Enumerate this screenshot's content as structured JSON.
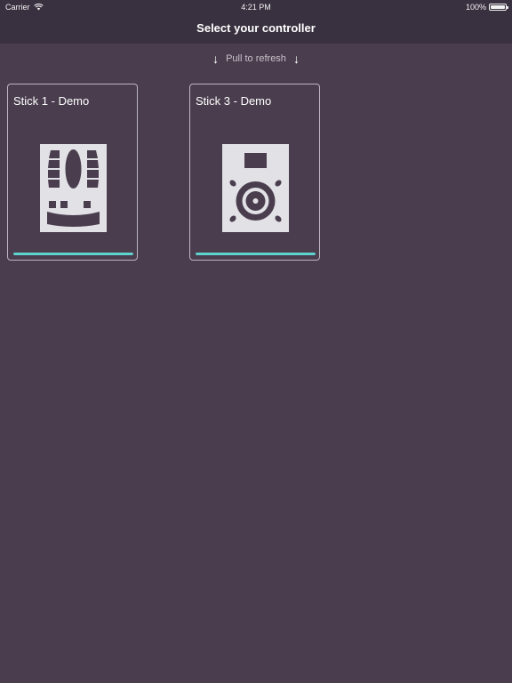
{
  "status_bar": {
    "carrier": "Carrier",
    "wifi_icon": "wifi-icon",
    "time": "4:21 PM",
    "battery_percent": "100%",
    "battery_level": 1.0
  },
  "nav": {
    "title": "Select your controller"
  },
  "pull_hint": {
    "text": "Pull to refresh",
    "arrow_left": "↓",
    "arrow_right": "↓"
  },
  "controllers": [
    {
      "name": "Stick 1 - Demo",
      "icon": "joystick-controller-icon",
      "progress": 1.0,
      "progress_color": "#5fd3d0"
    },
    {
      "name": "Stick 3 - Demo",
      "icon": "speaker-controller-icon",
      "progress": 1.0,
      "progress_color": "#5fd3d0"
    }
  ],
  "colors": {
    "background": "#4a3e4e",
    "bar": "#3a3140",
    "card_border": "#bdb6c0",
    "icon_fill": "#e2e1e6",
    "accent": "#5fd3d0"
  }
}
